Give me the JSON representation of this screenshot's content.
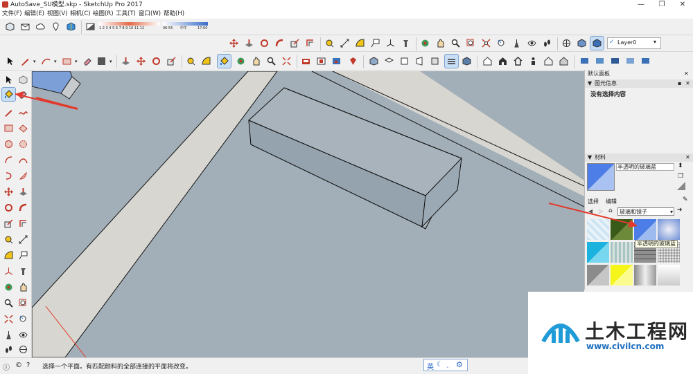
{
  "window": {
    "title": "AutoSave_SU模型.skp - SketchUp Pro 2017",
    "minimize": "—",
    "restore": "❐",
    "close": "✕"
  },
  "menu": [
    "文件(F)",
    "编辑(E)",
    "视图(V)",
    "相机(C)",
    "绘图(R)",
    "工具(T)",
    "窗口(W)",
    "帮助(H)"
  ],
  "shadow_bar": {
    "ticks": "1 2 3 4 5 6 7 8 9 10 11 12",
    "time_start": "06:55",
    "time_mid": "中午",
    "time_end": "17:00"
  },
  "layer": {
    "value": "Layer0"
  },
  "tray": {
    "title": "默认面板"
  },
  "entity_info": {
    "title": "图元信息",
    "value": "没有选择内容"
  },
  "materials": {
    "title": "材料",
    "name": "半透明的玻璃蓝",
    "tab_select": "选择",
    "tab_edit": "编辑",
    "library": "玻璃和镜子",
    "tooltip": "半透明的玻璃蓝",
    "swatch_colors": [
      "#cfe4f2",
      "#4e6a2a",
      "#4d7de6",
      "#6e8fd4",
      "#1bb2de",
      "#a8c4c0",
      "#8f8f8f",
      "#c4c4c4",
      "#8c8c8c",
      "#f5f51a",
      "#bdbdbd",
      "#e9e9e9"
    ]
  },
  "status": {
    "message": "选择一个平面。有匹配颜料的全部连接的平面将改变。"
  },
  "ime": {
    "label": "英"
  },
  "watermark": {
    "name": "土木工程网",
    "url": "www.civilcn.com"
  },
  "colors": {
    "viewport": "#a2afb8",
    "road": "#d8d6d0",
    "box": "#9aa9b4",
    "accent_arrow": "#e23a2c"
  }
}
